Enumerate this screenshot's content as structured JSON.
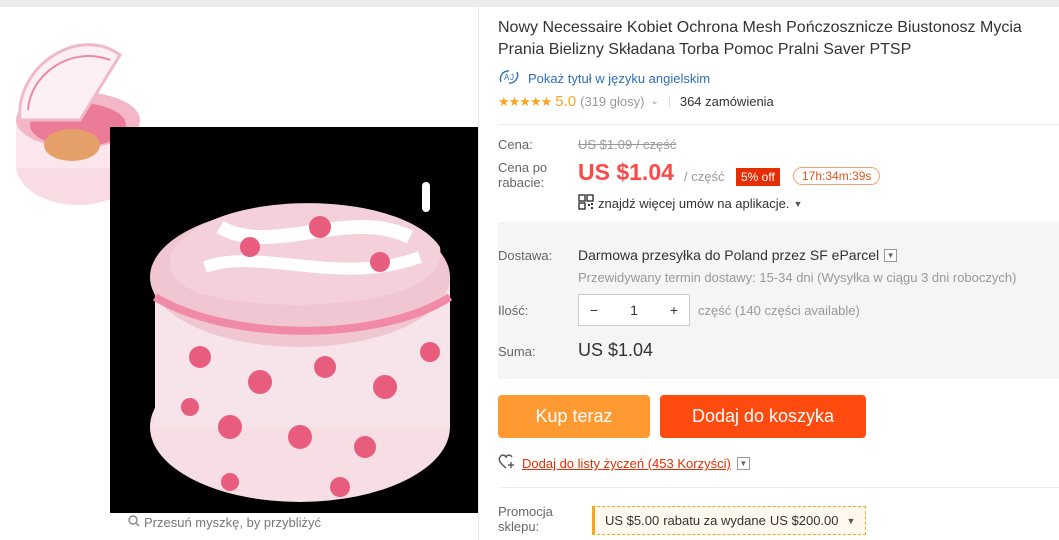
{
  "product": {
    "title": "Nowy Necessaire Kobiet Ochrona Mesh Pończosznicze Biustonosz Mycia Prania Bielizny Składana Torba Pomoc Pralni Saver PTSP",
    "translate_label": "Pokaż tytuł w języku angielskim",
    "rating_stars": "★★★★★",
    "rating_value": "5.0",
    "rating_votes": "(319 głosy)",
    "orders": "364 zamówienia"
  },
  "gallery": {
    "zoom_hint": "Przesuń myszkę, by przybliżyć"
  },
  "pricing": {
    "price_label": "Cena:",
    "old_price": "US $1.09 / część",
    "discount_price_label_1": "Cena po",
    "discount_price_label_2": "rabacie:",
    "price": "US $1.04",
    "unit": "/ część",
    "discount_badge": "5% off",
    "timer": "17h:34m:39s",
    "app_deals": "znajdź więcej umów na aplikacje."
  },
  "shipping": {
    "label": "Dostawa:",
    "text": "Darmowa przesyłka do Poland przez SF eParcel",
    "delivery_estimate": "Przewidywany termin dostawy: 15-34 dni (Wysyłka w ciągu 3 dni roboczych)"
  },
  "quantity": {
    "label": "Ilość:",
    "minus": "−",
    "value": "1",
    "plus": "+",
    "available": "część (140 części available)"
  },
  "total": {
    "label": "Suma:",
    "value": "US $1.04"
  },
  "actions": {
    "buy_now": "Kup teraz",
    "add_to_cart": "Dodaj do koszyka",
    "wishlist": "Dodaj do listy życzeń (453 Korzyści)"
  },
  "promotion": {
    "label_1": "Promocja",
    "label_2": "sklepu:",
    "amount": "US $5.00",
    "middle": "rabatu za wydane",
    "threshold": "US $200.00"
  },
  "colors": {
    "price_red": "#ff4747",
    "buy_orange": "#ff9a32",
    "cart_red": "#ff4a10",
    "link_blue": "#2f6fb7"
  }
}
